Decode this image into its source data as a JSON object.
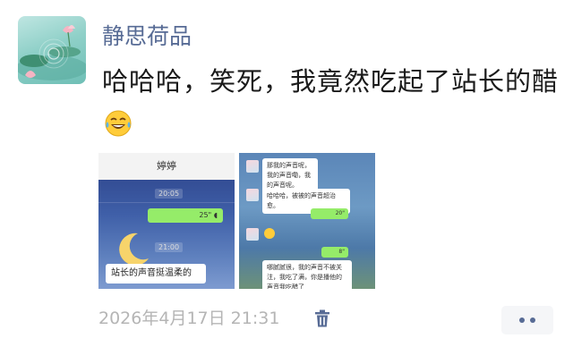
{
  "post": {
    "author": "静思荷品",
    "text": "哈哈哈，笑死，我竟然吃起了站长的醋",
    "emoji": "laughing-with-tears-emoji",
    "timestamp": "2026年4月17日 21:31"
  },
  "image1": {
    "header": "婷婷",
    "time1": "20:05",
    "bubble_duration": "25\"",
    "time2": "21:00",
    "message": "站长的声音挺温柔的"
  },
  "image2": {
    "msg1": "那我的声音呢，我的声音嘞，我的声音呢。",
    "msg2": "哈哈哈，被被的声音超治愈。",
    "voice1": "20\"",
    "voice2": "8\"",
    "msg3": "哪腻腻很，我的声音不被关注，我吃了满，你是播他的声音我吃醋了"
  },
  "icons": {
    "trash": "trash-icon",
    "more": "more-dots-icon"
  },
  "colors": {
    "author_link": "#576b95",
    "timestamp": "#b5b5b5",
    "chat_green": "#95ec69",
    "more_button_bg": "#f5f6f8"
  }
}
